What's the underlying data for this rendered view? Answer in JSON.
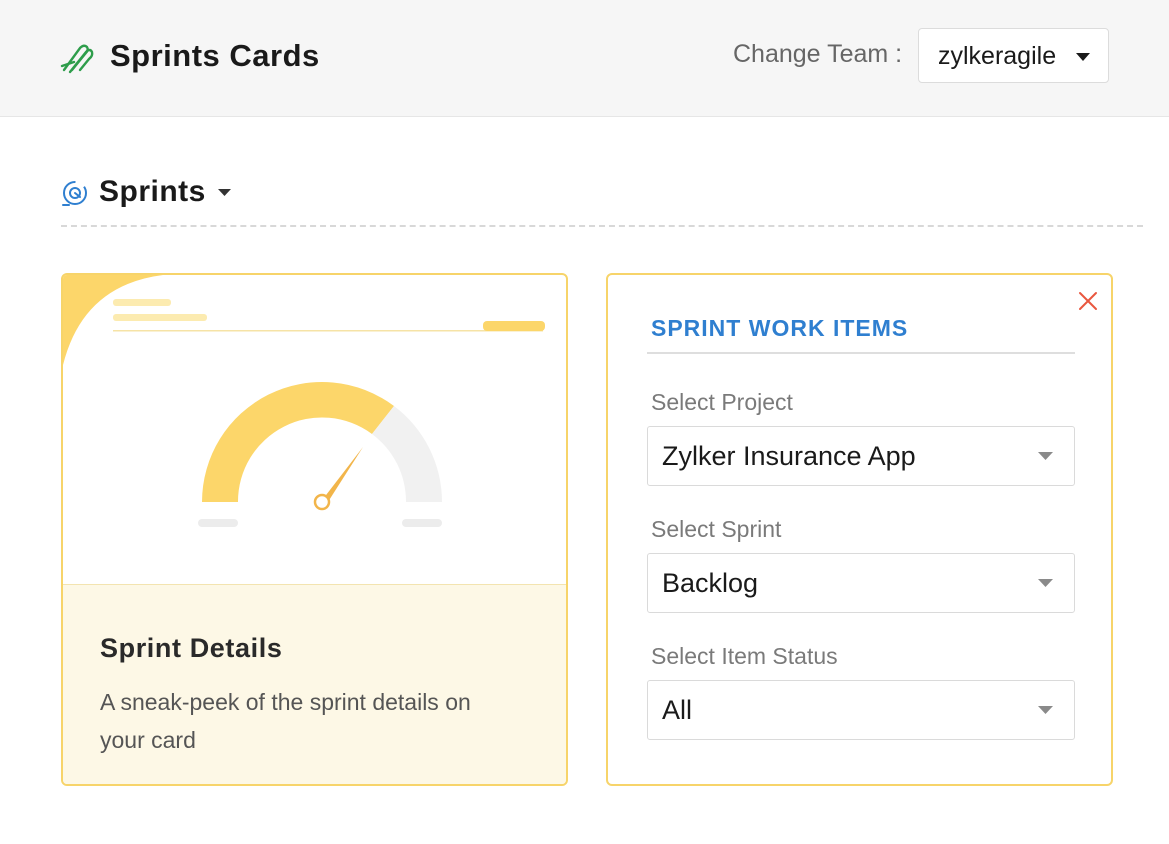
{
  "header": {
    "logo_icon": "sprints-logo-icon",
    "title": "Sprints Cards",
    "team_label": "Change Team :",
    "team_value": "zylkeragile"
  },
  "section": {
    "icon": "sprint-cycle-icon",
    "title": "Sprints"
  },
  "card_left": {
    "preview_icon": "gauge-illustration",
    "title": "Sprint Details",
    "description": "A sneak-peek of the sprint details on your card"
  },
  "card_right": {
    "title": "SPRINT WORK ITEMS",
    "fields": [
      {
        "label": "Select Project",
        "value": "Zylker Insurance App"
      },
      {
        "label": "Select Sprint",
        "value": "Backlog"
      },
      {
        "label": "Select Item Status",
        "value": "All"
      }
    ]
  },
  "colors": {
    "accent_blue": "#2f7fd0",
    "card_border": "#f7d46a",
    "close_red": "#e9573f",
    "logo_green": "#2e9d4b"
  }
}
